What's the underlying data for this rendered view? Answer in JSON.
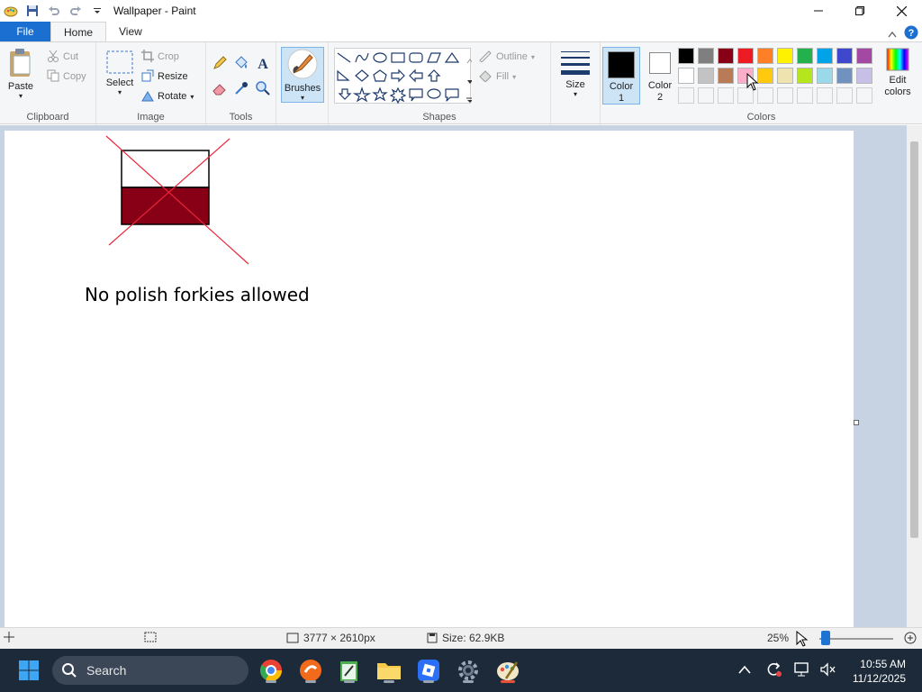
{
  "window": {
    "title": "Wallpaper - Paint"
  },
  "tabs": {
    "file": "File",
    "home": "Home",
    "view": "View"
  },
  "clipboard": {
    "paste": "Paste",
    "cut": "Cut",
    "copy": "Copy",
    "label": "Clipboard"
  },
  "image": {
    "select": "Select",
    "crop": "Crop",
    "resize": "Resize",
    "rotate": "Rotate",
    "label": "Image"
  },
  "tools": {
    "label": "Tools"
  },
  "brushes": {
    "label": "Brushes"
  },
  "shapes": {
    "outline": "Outline",
    "fill": "Fill",
    "label": "Shapes"
  },
  "size": {
    "label": "Size"
  },
  "colors": {
    "color1_line1": "Color",
    "color1_line2": "1",
    "color2_line1": "Color",
    "color2_line2": "2",
    "edit_line1": "Edit",
    "edit_line2": "colors",
    "label": "Colors",
    "color1_value": "#000000",
    "color2_value": "#ffffff",
    "palette_row1": [
      "#000000",
      "#7f7f7f",
      "#880015",
      "#ed1c24",
      "#ff7f27",
      "#fff200",
      "#22b14c",
      "#00a2e8",
      "#3f48cc",
      "#a349a4"
    ],
    "palette_row2": [
      "#ffffff",
      "#c3c3c3",
      "#b97a57",
      "#ffaec9",
      "#ffc90e",
      "#efe4b0",
      "#b5e61d",
      "#99d9ea",
      "#7092be",
      "#c8bfe7"
    ]
  },
  "canvas": {
    "text": "No polish forkies allowed",
    "flag_top": "#ffffff",
    "flag_bottom": "#880015",
    "cross_color": "#e8263a"
  },
  "status": {
    "dimensions": "3777 × 2610px",
    "size": "Size: 62.9KB",
    "zoom": "25%",
    "zoom_level_fraction": 0.25
  },
  "taskbar": {
    "search": "Search",
    "time": "10:55 AM",
    "date": "11/12/2025"
  }
}
